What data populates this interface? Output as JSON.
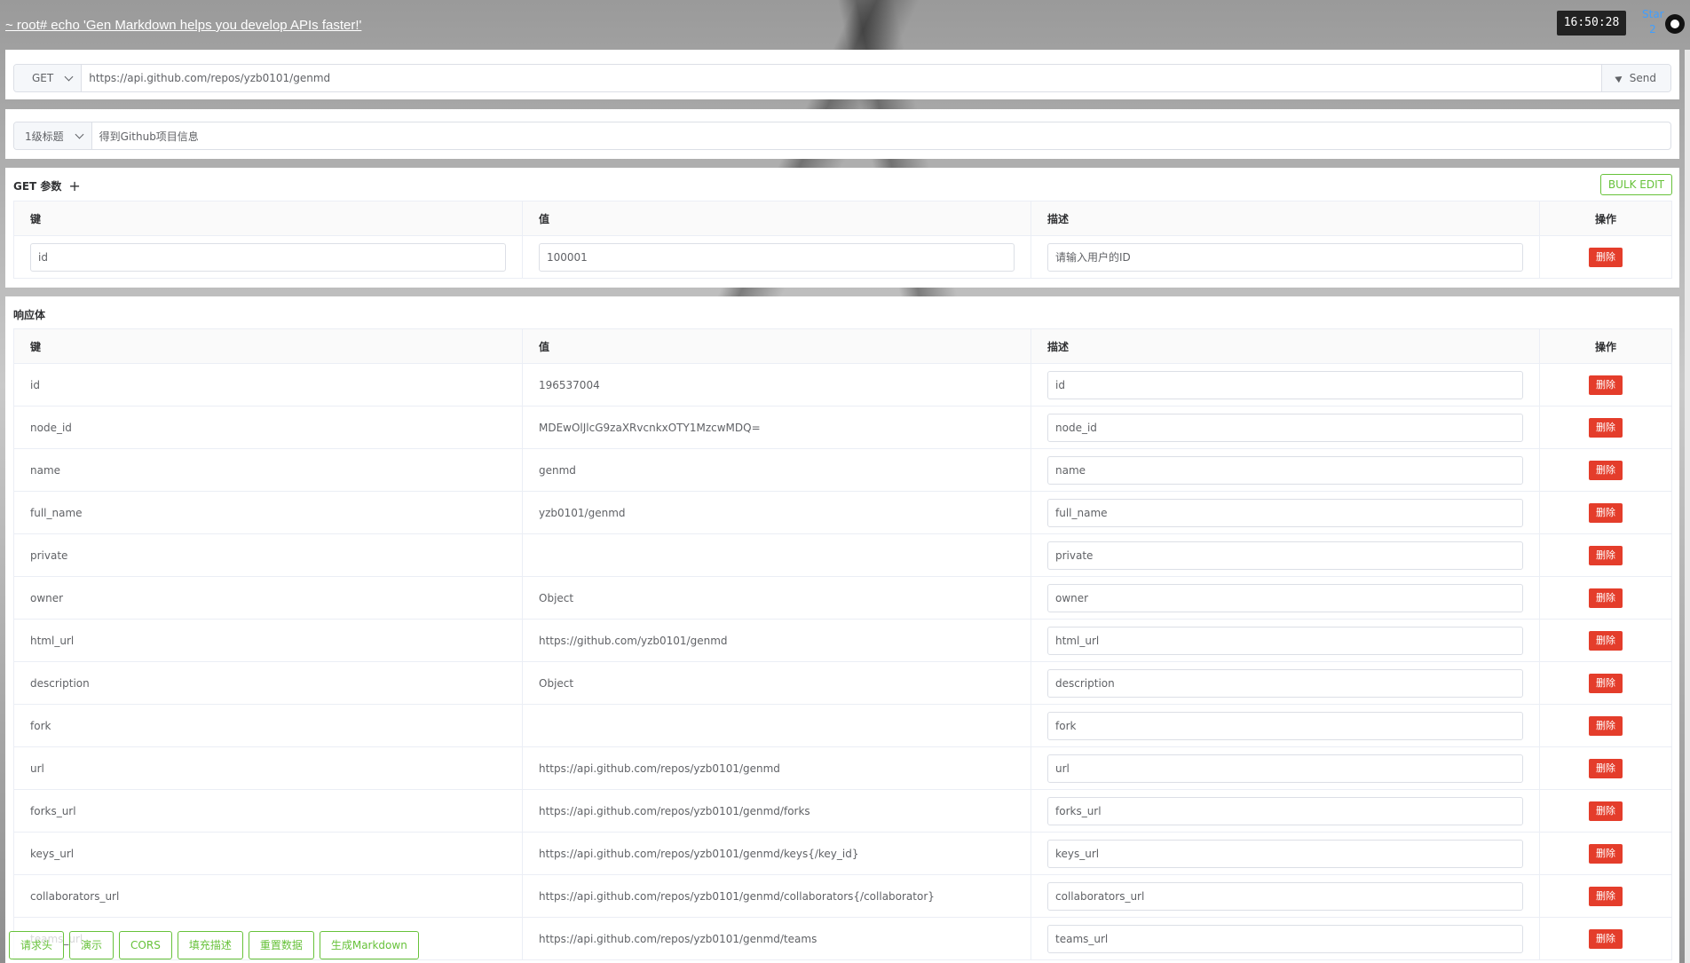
{
  "header": {
    "echo_text": "~ root# echo 'Gen Markdown helps you develop APIs faster!'",
    "clock": "16:50:28",
    "star_label": "Star",
    "star_count": "2"
  },
  "request": {
    "method": "GET",
    "url": "https://api.github.com/repos/yzb0101/genmd",
    "send_label": "Send"
  },
  "title_row": {
    "level": "1级标题",
    "title": "得到Github项目信息"
  },
  "get_params": {
    "section_title": "GET 参数",
    "bulk_edit": "BULK EDIT",
    "columns": [
      "键",
      "值",
      "描述",
      "操作"
    ],
    "rows": [
      {
        "key": "id",
        "value": "100001",
        "desc": "请输入用户的ID",
        "action": "删除"
      }
    ]
  },
  "response": {
    "section_title": "响应体",
    "columns": [
      "键",
      "值",
      "描述",
      "操作"
    ],
    "rows": [
      {
        "key": "id",
        "value": "196537004",
        "desc": "id",
        "action": "删除"
      },
      {
        "key": "node_id",
        "value": "MDEwOlJlcG9zaXRvcnkxOTY1MzcwMDQ=",
        "desc": "node_id",
        "action": "删除"
      },
      {
        "key": "name",
        "value": "genmd",
        "desc": "name",
        "action": "删除"
      },
      {
        "key": "full_name",
        "value": "yzb0101/genmd",
        "desc": "full_name",
        "action": "删除"
      },
      {
        "key": "private",
        "value": "",
        "desc": "private",
        "action": "删除"
      },
      {
        "key": "owner",
        "value": "Object",
        "desc": "owner",
        "action": "删除"
      },
      {
        "key": "html_url",
        "value": "https://github.com/yzb0101/genmd",
        "desc": "html_url",
        "action": "删除"
      },
      {
        "key": "description",
        "value": "Object",
        "desc": "description",
        "action": "删除"
      },
      {
        "key": "fork",
        "value": "",
        "desc": "fork",
        "action": "删除"
      },
      {
        "key": "url",
        "value": "https://api.github.com/repos/yzb0101/genmd",
        "desc": "url",
        "action": "删除"
      },
      {
        "key": "forks_url",
        "value": "https://api.github.com/repos/yzb0101/genmd/forks",
        "desc": "forks_url",
        "action": "删除"
      },
      {
        "key": "keys_url",
        "value": "https://api.github.com/repos/yzb0101/genmd/keys{/key_id}",
        "desc": "keys_url",
        "action": "删除"
      },
      {
        "key": "collaborators_url",
        "value": "https://api.github.com/repos/yzb0101/genmd/collaborators{/collaborator}",
        "desc": "collaborators_url",
        "action": "删除"
      },
      {
        "key": "teams_url",
        "value": "https://api.github.com/repos/yzb0101/genmd/teams",
        "desc": "teams_url",
        "action": "删除"
      }
    ]
  },
  "footer_buttons": [
    "请求头",
    "演示",
    "CORS",
    "填充描述",
    "重置数据",
    "生成Markdown"
  ],
  "colors": {
    "accent": "#67c23a",
    "danger": "#e43d2b",
    "link": "#409eff"
  },
  "icons": {
    "send": "send-icon",
    "github": "github-icon",
    "add": "plus-icon",
    "dropdown": "chevron-down-icon"
  }
}
